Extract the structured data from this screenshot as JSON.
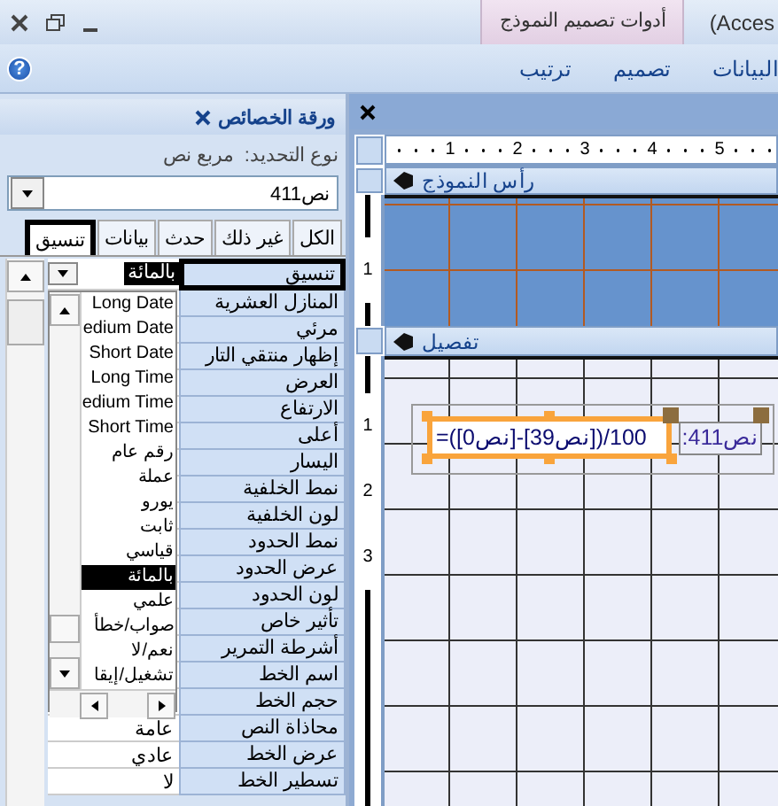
{
  "window": {
    "title": "(Acces",
    "context_tab": "أدوات تصميم النموذج"
  },
  "ribbon": {
    "help": "?",
    "tabs": [
      "البيانات",
      "تصميم",
      "ترتيب"
    ]
  },
  "property_sheet": {
    "title": "ورقة الخصائص",
    "selection_label": "نوع التحديد:",
    "selection_type": "مربع نص",
    "object": "نص411",
    "tabs": [
      {
        "label": "الكل",
        "selected": false
      },
      {
        "label": "غير ذلك",
        "selected": false
      },
      {
        "label": "حدث",
        "selected": false
      },
      {
        "label": "بيانات",
        "selected": false
      },
      {
        "label": "تنسيق",
        "selected": true
      }
    ],
    "properties": [
      {
        "name": "تنسيق",
        "value": "بالمائة",
        "selected": true
      },
      {
        "name": "المنازل العشرية",
        "selected": false
      },
      {
        "name": "مرئي",
        "selected": false
      },
      {
        "name": "إظهار منتقي التار",
        "selected": false
      },
      {
        "name": "العرض",
        "selected": false
      },
      {
        "name": "الارتفاع",
        "selected": false
      },
      {
        "name": "أعلى",
        "selected": false
      },
      {
        "name": "اليسار",
        "selected": false
      },
      {
        "name": "نمط الخلفية",
        "selected": false
      },
      {
        "name": "لون الخلفية",
        "selected": false
      },
      {
        "name": "نمط الحدود",
        "selected": false
      },
      {
        "name": "عرض الحدود",
        "selected": false
      },
      {
        "name": "لون الحدود",
        "selected": false
      },
      {
        "name": "تأثير خاص",
        "selected": false
      },
      {
        "name": "أشرطة التمرير",
        "selected": false
      },
      {
        "name": "اسم الخط",
        "selected": false
      },
      {
        "name": "حجم الخط",
        "selected": false
      },
      {
        "name": "محاذاة النص",
        "value": "عامة",
        "selected": false
      },
      {
        "name": "عرض الخط",
        "value": "عادي",
        "selected": false
      },
      {
        "name": "تسطير الخط",
        "value": "لا",
        "selected": false
      }
    ],
    "format_list": [
      {
        "label": "Long Date",
        "selected": false
      },
      {
        "label": "edium Date",
        "selected": false
      },
      {
        "label": "Short Date",
        "selected": false
      },
      {
        "label": "Long Time",
        "selected": false
      },
      {
        "label": "edium Time",
        "selected": false
      },
      {
        "label": "Short Time",
        "selected": false
      },
      {
        "label": "رقم عام",
        "selected": false
      },
      {
        "label": "عملة",
        "selected": false
      },
      {
        "label": "يورو",
        "selected": false
      },
      {
        "label": "ثابت",
        "selected": false
      },
      {
        "label": "قياسي",
        "selected": false
      },
      {
        "label": "بالمائة",
        "selected": true
      },
      {
        "label": "علمي",
        "selected": false
      },
      {
        "label": "صواب/خطأ",
        "selected": false
      },
      {
        "label": "نعم/لا",
        "selected": false
      },
      {
        "label": "تشغيل/إيقا",
        "selected": false
      }
    ]
  },
  "design": {
    "ruler": [
      "5",
      "4",
      "3",
      "2",
      "1"
    ],
    "sections": [
      {
        "kind": "header",
        "title": "رأس النموذج",
        "ruler": [
          "1"
        ]
      },
      {
        "kind": "detail",
        "title": "تفصيل",
        "ruler": [
          "1",
          "2",
          "3"
        ]
      }
    ],
    "controls": [
      {
        "kind": "label",
        "text": "نص411:"
      },
      {
        "kind": "textbox",
        "text": "=([نص0]-[نص39])/100",
        "selected": true
      }
    ]
  }
}
